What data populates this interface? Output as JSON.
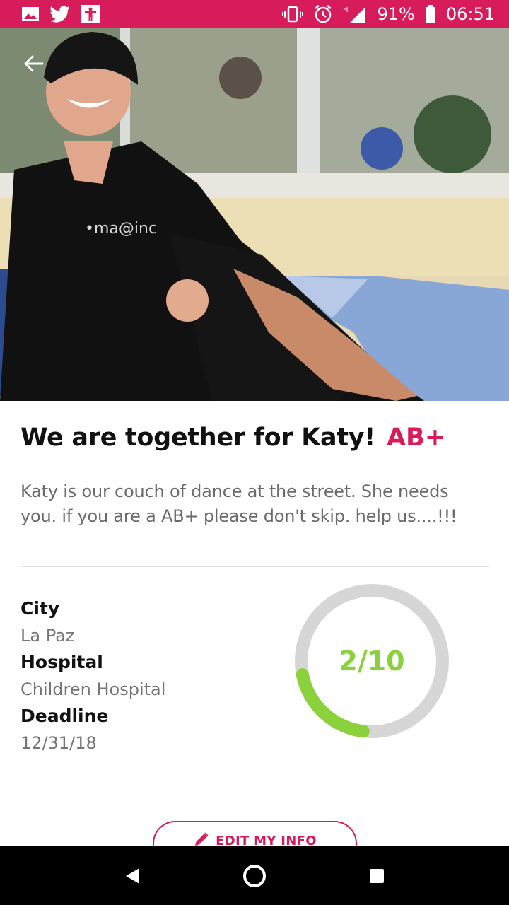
{
  "status_bar": {
    "battery": "91%",
    "time": "06:51",
    "icons_left": [
      "image-icon",
      "twitter-icon",
      "accessibility-icon"
    ],
    "icons_right": [
      "vibrate-icon",
      "alarm-icon",
      "signal-icon",
      "battery-icon"
    ]
  },
  "campaign": {
    "title": "We are together for Katy!",
    "blood_type": "AB+",
    "description": "Katy is our couch of dance at the street. She needs you. if you are a AB+ please don't skip. help us....!!!",
    "details": [
      {
        "label": "City",
        "value": "La Paz"
      },
      {
        "label": "Hospital",
        "value": "Children Hospital"
      },
      {
        "label": "Deadline",
        "value": "12/31/18"
      }
    ],
    "progress": {
      "text": "2/10",
      "current": 2,
      "goal": 10
    },
    "edit_button": "EDIT MY INFO"
  },
  "colors": {
    "accent": "#d81b5a",
    "progress": "#8bd13c",
    "ring_track": "#d6d6d6"
  },
  "nav": {
    "icons": [
      "back-icon",
      "home-icon",
      "recents-icon"
    ]
  }
}
